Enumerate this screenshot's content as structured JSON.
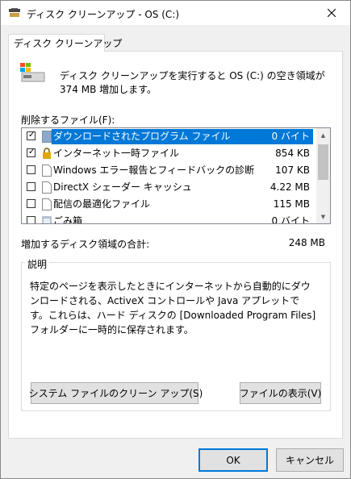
{
  "window": {
    "title": "ディスク クリーンアップ - OS (C:)",
    "close_glyph": "✕"
  },
  "tab": {
    "label": "ディスク クリーンアップ"
  },
  "intro": {
    "text": "ディスク クリーンアップを実行すると OS (C:) の空き領域が 374 MB 増加します。",
    "icon": "drive-icon"
  },
  "files_label": "削除するファイル(F):",
  "files": [
    {
      "checked": true,
      "locked": false,
      "icon": "folder-icon",
      "name": "ダウンロードされたプログラム ファイル",
      "size": "0 バイト",
      "selected": true
    },
    {
      "checked": true,
      "locked": true,
      "icon": "lock-icon",
      "name": "インターネット一時ファイル",
      "size": "854 KB",
      "selected": false
    },
    {
      "checked": false,
      "locked": false,
      "icon": "file-icon",
      "name": "Windows エラー報告とフィードバックの診断",
      "size": "107 KB",
      "selected": false
    },
    {
      "checked": false,
      "locked": false,
      "icon": "file-icon",
      "name": "DirectX シェーダー キャッシュ",
      "size": "4.22 MB",
      "selected": false
    },
    {
      "checked": false,
      "locked": false,
      "icon": "file-icon",
      "name": "配信の最適化ファイル",
      "size": "115 MB",
      "selected": false
    },
    {
      "checked": false,
      "locked": false,
      "icon": "recycle-bin-icon",
      "name": "ごみ箱",
      "size": "0 バイト",
      "selected": false
    }
  ],
  "scroll": {
    "up": "▲",
    "down": "▼"
  },
  "total": {
    "label": "増加するディスク領域の合計:",
    "value": "248 MB"
  },
  "description": {
    "legend": "説明",
    "text": "特定のページを表示したときにインターネットから自動的にダウンロードされる、ActiveX コントロールや Java アプレットです。これらは、ハード ディスクの [Downloaded Program Files] フォルダーに一時的に保存されます。"
  },
  "buttons": {
    "cleanup_system": "システム ファイルのクリーン アップ(S)",
    "view_files": "ファイルの表示(V)",
    "ok": "OK",
    "cancel": "キャンセル"
  },
  "colors": {
    "selection": "#0078d7",
    "default_button_border": "#0078d7"
  }
}
